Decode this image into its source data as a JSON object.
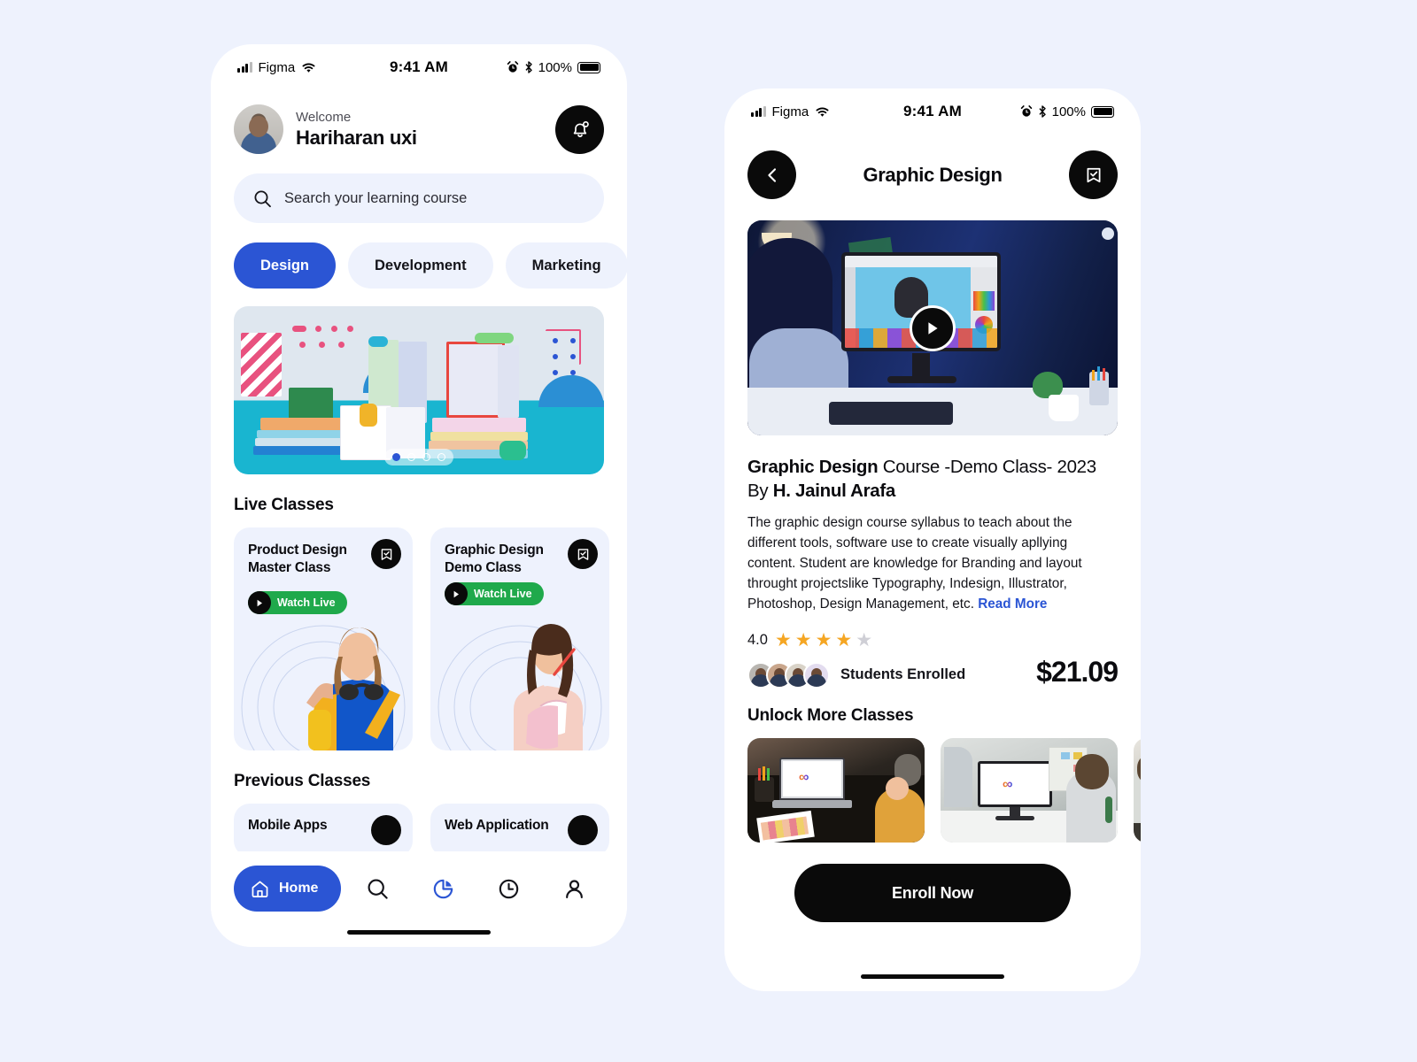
{
  "theme": {
    "page_bg": "#eef2fd",
    "accent_blue": "#2b55d4",
    "live_green": "#1fa94b",
    "star_gold": "#f5a623",
    "dark": "#0a0a0a"
  },
  "left_phone": {
    "status_bar": {
      "carrier": "Figma",
      "time": "9:41 AM",
      "battery_pct": "100%",
      "icons": [
        "signal-icon",
        "wifi-icon",
        "alarm-icon",
        "bluetooth-icon",
        "battery-icon"
      ]
    },
    "header": {
      "welcome_label": "Welcome",
      "user_name": "Hariharan uxi",
      "avatar_name": "user-avatar",
      "bell_icon": "bell-icon"
    },
    "search": {
      "placeholder": "Search your learning course",
      "icon": "search-icon"
    },
    "tabs": [
      {
        "label": "Design",
        "active": true
      },
      {
        "label": "Development",
        "active": false
      },
      {
        "label": "Marketing",
        "active": false
      }
    ],
    "carousel": {
      "dots_total": 4,
      "active_dot": 1,
      "alt": "books-illustration-banner"
    },
    "live_classes": {
      "section_title": "Live Classes",
      "items": [
        {
          "title": "Product Design Master Class",
          "badge": "Watch Live",
          "bookmark_icon": "bookmark-check-icon",
          "play_icon": "play-icon"
        },
        {
          "title": "Graphic Design Demo Class",
          "badge": "Watch Live",
          "bookmark_icon": "bookmark-check-icon",
          "play_icon": "play-icon"
        }
      ]
    },
    "previous_classes": {
      "section_title": "Previous Classes",
      "items": [
        {
          "title": "Mobile Apps",
          "bookmark_icon": "bookmark-check-icon"
        },
        {
          "title": "Web Application",
          "bookmark_icon": "bookmark-check-icon"
        }
      ]
    },
    "bottom_nav": {
      "home_label": "Home",
      "items": [
        {
          "name": "home",
          "icon": "home-icon",
          "label": "Home",
          "active": true
        },
        {
          "name": "search",
          "icon": "search-icon",
          "label": "",
          "active": false
        },
        {
          "name": "stats",
          "icon": "pie-chart-icon",
          "label": "",
          "active": true
        },
        {
          "name": "history",
          "icon": "clock-icon",
          "label": "",
          "active": false
        },
        {
          "name": "profile",
          "icon": "person-icon",
          "label": "",
          "active": false
        }
      ]
    }
  },
  "right_phone": {
    "status_bar": {
      "carrier": "Figma",
      "time": "9:41 AM",
      "battery_pct": "100%"
    },
    "header": {
      "back_icon": "chevron-left-icon",
      "title": "Graphic Design",
      "bookmark_icon": "bookmark-check-icon"
    },
    "video": {
      "play_icon": "play-icon",
      "alt": "designer-at-computer-video"
    },
    "course": {
      "title_bold": "Graphic Design",
      "title_rest": " Course -Demo Class- 2023",
      "by_label": "By ",
      "author": "H. Jainul Arafa",
      "description": "The graphic design course syllabus to teach about the different tools, software use to create visually apllying content. Student are knowledge for Branding and layout throught projectslike Typography, Indesign, Illustrator, Photoshop, Design Management, etc. ",
      "read_more": "Read More"
    },
    "rating": {
      "value": "4.0",
      "stars_filled": 4,
      "stars_total": 5
    },
    "enrolled": {
      "label": "Students Enrolled",
      "avatar_count": 4
    },
    "price": "$21.09",
    "unlock": {
      "section_title": "Unlock More Classes",
      "thumbs": [
        {
          "alt": "laptop-design-workspace"
        },
        {
          "alt": "imac-design-workspace"
        },
        {
          "alt": "studio-workspace"
        }
      ]
    },
    "enroll_button": "Enroll Now"
  }
}
